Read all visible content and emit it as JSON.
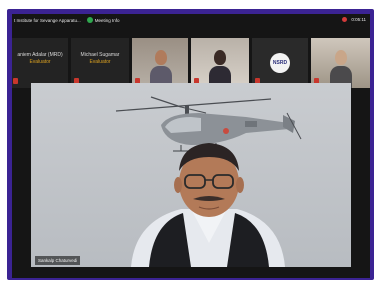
{
  "window": {
    "title": "t Institute for Sevange Apparatu...",
    "meeting_info_label": "Meeting Info",
    "time": "0:05:11"
  },
  "participants": [
    {
      "name": "aniem Adalar (MRD)",
      "role": "Evaluator"
    },
    {
      "name": "Michael Sugamar",
      "role": "Evaluator"
    },
    {
      "name": "",
      "role": ""
    },
    {
      "name": "",
      "role": ""
    },
    {
      "name": "",
      "role": ""
    },
    {
      "name": "",
      "role": ""
    }
  ],
  "video_tiles": {
    "logo_text": "NSRD"
  },
  "main_video": {
    "speaker_label": "Sankalp Chaturvedi"
  },
  "colors": {
    "frame": "#3b2393",
    "role": "#d9a021",
    "mic_muted": "#c8372d"
  }
}
